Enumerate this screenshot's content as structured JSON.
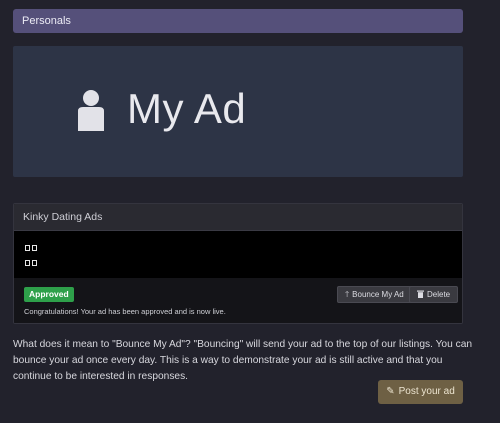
{
  "section": {
    "title": "Personals"
  },
  "hero": {
    "title": "My Ad",
    "icon": "user-icon"
  },
  "ad": {
    "category": "Kinky Dating Ads",
    "status_badge": "Approved",
    "status_message": "Congratulations! Your ad has been approved and is now live.",
    "bounce_label": "Bounce My Ad",
    "bounce_icon": "arrow-up-icon",
    "delete_label": "Delete",
    "delete_icon": "trash-icon",
    "badge_color": "#2ea04a"
  },
  "explanation": "What does it mean to \"Bounce My Ad\"? \"Bouncing\" will send your ad to the top of our listings. You can bounce your ad once every day. This is a way to demonstrate your ad is still active and that you continue to be interested in responses.",
  "post_button": {
    "label": "Post your ad",
    "icon": "edit-icon"
  },
  "colors": {
    "background": "#22222c",
    "header": "#55507a",
    "hero": "#2d3446",
    "post_button": "#6e6044"
  }
}
